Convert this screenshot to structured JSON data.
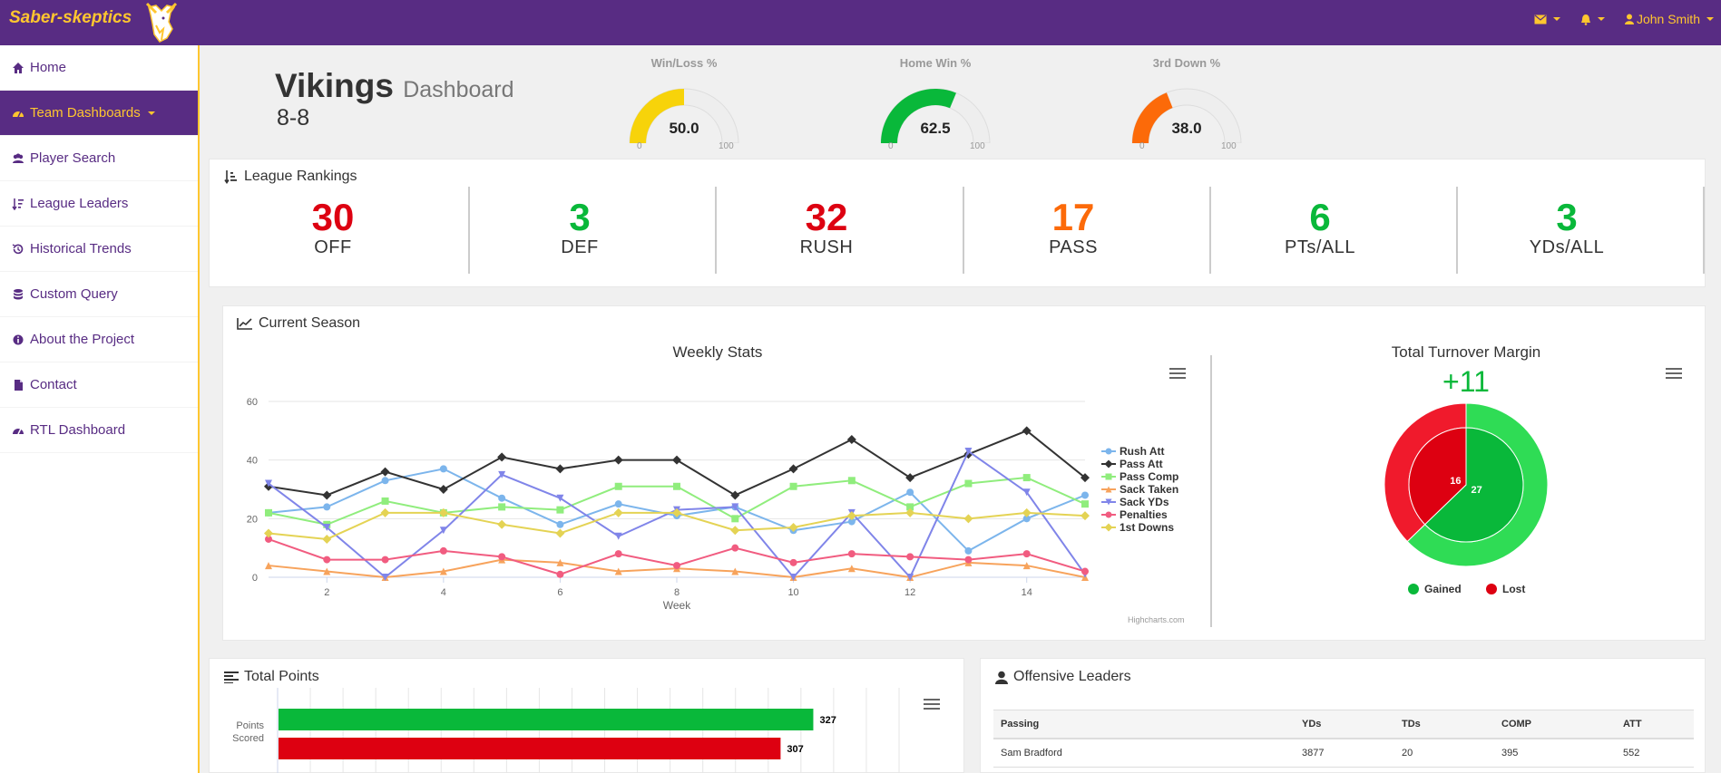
{
  "navbar": {
    "brand": "Saber-skeptics",
    "user": "John Smith",
    "colors": {
      "primary": "#582c83",
      "accent": "#ffc62f"
    }
  },
  "sidebar": {
    "items": [
      {
        "label": "Home",
        "icon": "home-icon"
      },
      {
        "label": "Team Dashboards",
        "icon": "dashboard-icon"
      },
      {
        "label": "Player Search",
        "icon": "users-icon"
      },
      {
        "label": "League Leaders",
        "icon": "sort-icon"
      },
      {
        "label": "Historical Trends",
        "icon": "history-icon"
      },
      {
        "label": "Custom Query",
        "icon": "database-icon"
      },
      {
        "label": "About the Project",
        "icon": "info-icon"
      },
      {
        "label": "Contact",
        "icon": "file-icon"
      },
      {
        "label": "RTL Dashboard",
        "icon": "dashboard-icon"
      }
    ]
  },
  "header": {
    "team": "Vikings",
    "subtitle": "Dashboard",
    "record": "8-8"
  },
  "gauges": [
    {
      "label": "Win/Loss %",
      "value": "50.0",
      "pct": 50.0,
      "color": "#f7d30a",
      "min": "0",
      "max": "100"
    },
    {
      "label": "Home Win %",
      "value": "62.5",
      "pct": 62.5,
      "color": "#09b83a",
      "min": "0",
      "max": "100"
    },
    {
      "label": "3rd Down %",
      "value": "38.0",
      "pct": 38.0,
      "color": "#fc6a09",
      "min": "0",
      "max": "100"
    }
  ],
  "rankings": {
    "title": "League Rankings",
    "items": [
      {
        "value": "30",
        "label": "OFF",
        "color": "#dd0011"
      },
      {
        "value": "3",
        "label": "DEF",
        "color": "#09b83a"
      },
      {
        "value": "32",
        "label": "RUSH",
        "color": "#dd0011"
      },
      {
        "value": "17",
        "label": "PASS",
        "color": "#fc6a09"
      },
      {
        "value": "6",
        "label": "PTs/ALL",
        "color": "#09b83a"
      },
      {
        "value": "3",
        "label": "YDs/ALL",
        "color": "#09b83a"
      }
    ]
  },
  "current_season": {
    "title": "Current Season",
    "credits": "Highcharts.com"
  },
  "total_points": {
    "title": "Total Points"
  },
  "offensive_leaders": {
    "title": "Offensive Leaders",
    "columns": [
      "Passing",
      "YDs",
      "TDs",
      "COMP",
      "ATT"
    ],
    "rows": [
      [
        "Sam Bradford",
        "3877",
        "20",
        "395",
        "552"
      ]
    ]
  },
  "chart_data": [
    {
      "type": "line",
      "title": "Weekly Stats",
      "xlabel": "Week",
      "ylabel": "",
      "x": [
        1,
        2,
        3,
        4,
        5,
        6,
        7,
        8,
        9,
        10,
        11,
        12,
        13,
        14,
        15
      ],
      "xticks": [
        "2",
        "4",
        "6",
        "8",
        "10",
        "12",
        "14"
      ],
      "yticks": [
        "0",
        "20",
        "40",
        "60"
      ],
      "ylim": [
        0,
        60
      ],
      "legend": "right",
      "grid": true,
      "series": [
        {
          "name": "Rush Att",
          "color": "#7cb5ec",
          "marker": "circle",
          "values": [
            22,
            24,
            33,
            37,
            27,
            18,
            25,
            21,
            24,
            16,
            19,
            29,
            9,
            20,
            28
          ]
        },
        {
          "name": "Pass Att",
          "color": "#333333",
          "marker": "diamond",
          "values": [
            31,
            28,
            36,
            30,
            41,
            37,
            40,
            40,
            28,
            37,
            47,
            34,
            42,
            50,
            34
          ]
        },
        {
          "name": "Pass Comp",
          "color": "#90ed7d",
          "marker": "square",
          "values": [
            22,
            18,
            26,
            22,
            24,
            23,
            31,
            31,
            20,
            31,
            33,
            24,
            32,
            34,
            25
          ]
        },
        {
          "name": "Sack Taken",
          "color": "#f7a35c",
          "marker": "triangle",
          "values": [
            4,
            2,
            0,
            2,
            6,
            5,
            2,
            3,
            2,
            0,
            3,
            0,
            5,
            4,
            0
          ]
        },
        {
          "name": "Sack YDs",
          "color": "#8085e9",
          "marker": "triangle-down",
          "values": [
            32,
            17,
            0,
            16,
            35,
            27,
            14,
            23,
            24,
            0,
            22,
            0,
            43,
            29,
            1
          ]
        },
        {
          "name": "Penalties",
          "color": "#f15c80",
          "marker": "circle",
          "values": [
            13,
            6,
            6,
            9,
            7,
            1,
            8,
            4,
            10,
            5,
            8,
            7,
            6,
            8,
            2
          ]
        },
        {
          "name": "1st Downs",
          "color": "#e4d354",
          "marker": "diamond",
          "values": [
            15,
            13,
            22,
            22,
            18,
            15,
            22,
            22,
            16,
            17,
            21,
            22,
            20,
            22,
            21
          ]
        }
      ]
    },
    {
      "type": "pie",
      "title": "Total Turnover Margin",
      "subtitle": "+11",
      "legend": "bottom",
      "inner": [
        {
          "name": "Gained",
          "value": 27,
          "color": "#09b83a"
        },
        {
          "name": "Lost",
          "value": 16,
          "color": "#dd0011"
        }
      ],
      "outer": [
        {
          "name": "Gained",
          "value": 27,
          "color": "#2fdc55"
        },
        {
          "name": "Lost",
          "value": 16,
          "color": "#f01a2c"
        }
      ]
    },
    {
      "type": "bar",
      "title": "",
      "categories": [
        "Points Scored"
      ],
      "series": [
        {
          "name": "",
          "values": [
            327
          ],
          "color": "#09b83a"
        },
        {
          "name": "",
          "values": [
            307
          ],
          "color": "#dd0011"
        }
      ],
      "xlim": [
        0,
        380
      ]
    }
  ]
}
